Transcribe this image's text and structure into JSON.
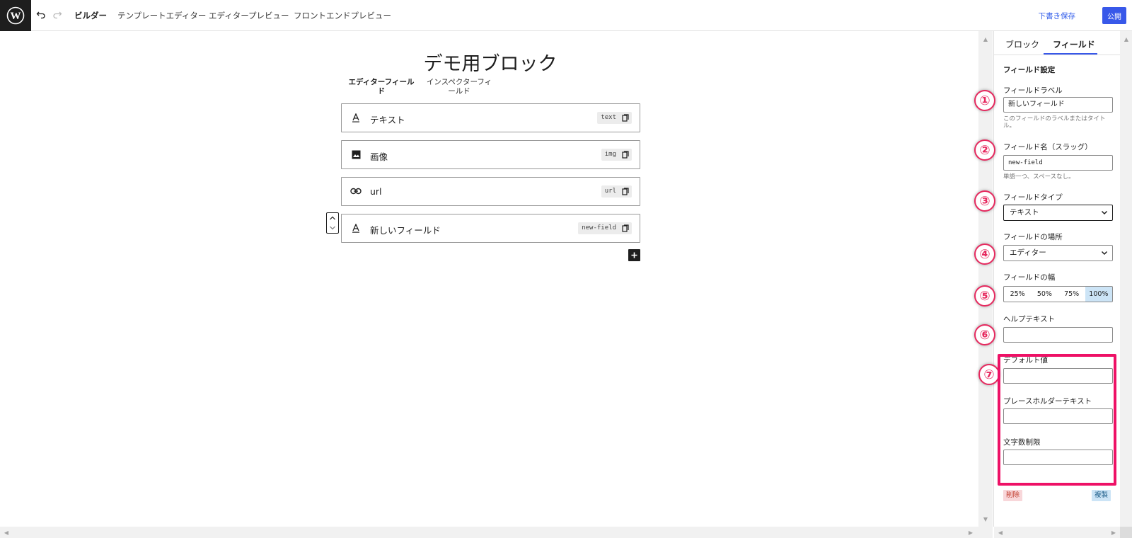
{
  "header": {
    "undo_icon": "undo-icon",
    "redo_icon": "redo-icon",
    "tabs": [
      {
        "label": "ビルダー",
        "active": true
      },
      {
        "label": "テンプレートエディター",
        "active": false
      },
      {
        "label": "エディタープレビュー",
        "active": false
      },
      {
        "label": "フロントエンドプレビュー",
        "active": false
      }
    ],
    "save_draft": "下書き保存",
    "publish": "公開"
  },
  "canvas": {
    "block_title": "デモ用ブロック",
    "tabs": [
      {
        "label": "エディターフィールド",
        "active": true
      },
      {
        "label": "インスペクターフィールド",
        "active": false
      }
    ],
    "fields": [
      {
        "icon": "text-icon",
        "label": "テキスト",
        "slug": "text"
      },
      {
        "icon": "image-icon",
        "label": "画像",
        "slug": "img"
      },
      {
        "icon": "link-icon",
        "label": "url",
        "slug": "url"
      },
      {
        "icon": "text-icon",
        "label": "新しいフィールド",
        "slug": "new-field",
        "selected": true
      }
    ],
    "add_icon": "plus-icon"
  },
  "sidebar": {
    "tabs": [
      {
        "label": "ブロック",
        "active": false
      },
      {
        "label": "フィールド",
        "active": true
      }
    ],
    "section_title": "フィールド設定",
    "field_label": {
      "label": "フィールドラベル",
      "value": "新しいフィールド",
      "help": "このフィールドのラベルまたはタイトル。"
    },
    "field_name": {
      "label": "フィールド名（スラッグ）",
      "value": "new-field",
      "help": "単語一つ、スペースなし。"
    },
    "field_type": {
      "label": "フィールドタイプ",
      "value": "テキスト"
    },
    "field_location": {
      "label": "フィールドの場所",
      "value": "エディター"
    },
    "field_width": {
      "label": "フィールドの幅",
      "options": [
        "25%",
        "50%",
        "75%",
        "100%"
      ],
      "selected": "100%"
    },
    "help_text": {
      "label": "ヘルプテキスト",
      "value": ""
    },
    "default_value": {
      "label": "デフォルト値",
      "value": ""
    },
    "placeholder_text": {
      "label": "プレースホルダーテキスト",
      "value": ""
    },
    "char_limit": {
      "label": "文字数制限",
      "value": ""
    },
    "delete": "削除",
    "duplicate": "複製"
  },
  "annotations": {
    "badges": [
      "①",
      "②",
      "③",
      "④",
      "⑤",
      "⑥",
      "⑦"
    ],
    "badge_color": "#e6295f",
    "highlight_color": "#ee1166"
  },
  "colors": {
    "accent": "#3858e9",
    "selected_width": "#cce4f6",
    "delete_bg": "#f8d7da"
  }
}
